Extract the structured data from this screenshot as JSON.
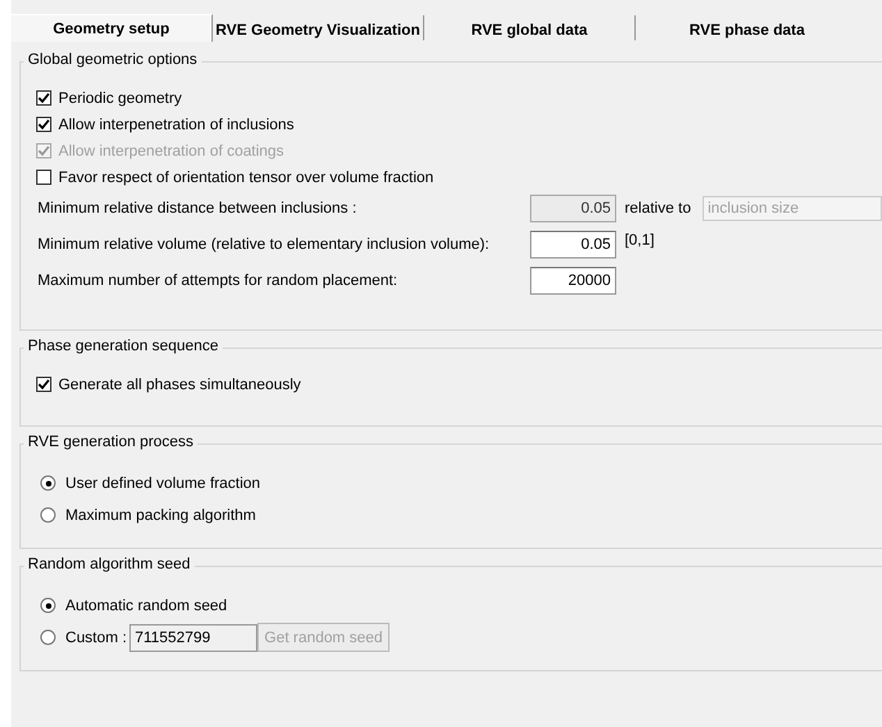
{
  "tabs": [
    {
      "label": "Geometry setup",
      "selected": true
    },
    {
      "label": "RVE Geometry Visualization",
      "selected": false
    },
    {
      "label": "RVE global data",
      "selected": false
    },
    {
      "label": "RVE phase data",
      "selected": false
    }
  ],
  "groups": [
    {
      "title": "Global geometric options",
      "items": [
        {
          "kind": "checkbox",
          "label": "Periodic geometry",
          "checked": true,
          "disabled": false
        },
        {
          "kind": "checkbox",
          "label": "Allow interpenetration of inclusions",
          "checked": true,
          "disabled": false
        },
        {
          "kind": "checkbox",
          "label": "Allow interpenetration of coatings",
          "checked": true,
          "disabled": true
        },
        {
          "kind": "checkbox",
          "label": "Favor respect of orientation tensor over volume fraction",
          "checked": false,
          "disabled": false
        },
        {
          "kind": "number",
          "label": "Minimum relative distance between inclusions :",
          "value": "0.05",
          "disabled": true,
          "relative_label": "relative to",
          "dropdown": {
            "value": "inclusion size",
            "disabled": true
          }
        },
        {
          "kind": "number",
          "label": "Minimum relative volume (relative to elementary inclusion volume):",
          "value": "0.05",
          "disabled": false,
          "suffix": "[0,1]"
        },
        {
          "kind": "number",
          "label": "Maximum number of attempts for random placement:",
          "value": "20000",
          "disabled": false
        }
      ]
    },
    {
      "title": "Phase generation sequence",
      "items": [
        {
          "kind": "checkbox",
          "label": "Generate all phases simultaneously",
          "checked": true,
          "disabled": false
        }
      ]
    },
    {
      "title": "RVE generation process",
      "items": [
        {
          "kind": "radio",
          "label": "User defined volume fraction",
          "selected": true
        },
        {
          "kind": "radio",
          "label": "Maximum packing algorithm",
          "selected": false
        }
      ]
    },
    {
      "title": "Random algorithm seed",
      "items": [
        {
          "kind": "radio",
          "label": "Automatic random seed",
          "selected": true
        },
        {
          "kind": "radio_input",
          "label": "Custom :",
          "selected": false,
          "value": "711552799",
          "button": {
            "label": "Get random seed",
            "disabled": true
          }
        }
      ]
    }
  ]
}
